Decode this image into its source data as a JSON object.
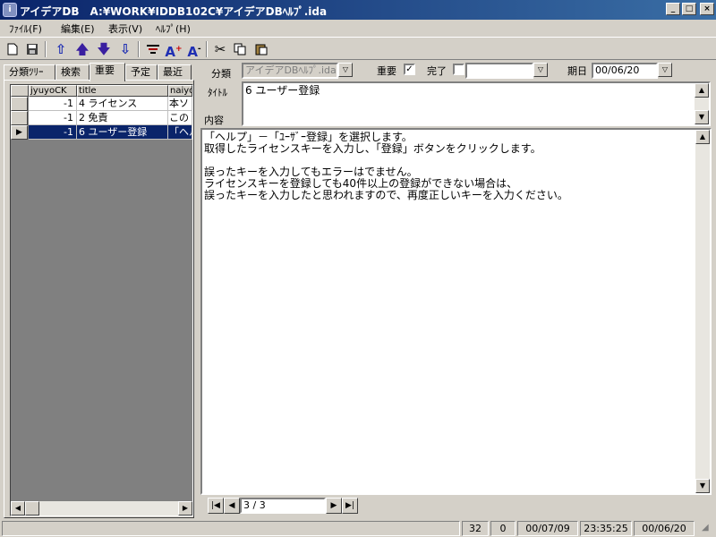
{
  "window": {
    "title": "アイデアDB　A:¥WORK¥IDDB102C¥アイデアDBﾍﾙﾌﾟ.ida",
    "icon": "app-icon",
    "controls": [
      "minimize",
      "maximize",
      "close"
    ]
  },
  "menu": [
    "ﾌｧｲﾙ(F)",
    "編集(E)",
    "表示(V)",
    "ﾍﾙﾌﾟ(H)"
  ],
  "toolbar": {
    "buttons": [
      "new",
      "save",
      "move-up",
      "up",
      "down",
      "move-down",
      "filter",
      "font-larger",
      "font-smaller",
      "cut",
      "copy",
      "paste"
    ]
  },
  "tabs": [
    "分類ﾂﾘｰ",
    "検索",
    "重要",
    "予定",
    "最近"
  ],
  "active_tab": "重要",
  "grid": {
    "columns": [
      "jyuyoCK",
      "title",
      "naiyo"
    ],
    "rows": [
      {
        "jyuyoCK": "-1",
        "title": "4 ライセンス",
        "naiyo": "本ソ",
        "selected": false
      },
      {
        "jyuyoCK": "-1",
        "title": "2 免責",
        "naiyo": "この",
        "selected": false
      },
      {
        "jyuyoCK": "-1",
        "title": "6 ユーザー登録",
        "naiyo": "「ヘル",
        "selected": true
      }
    ]
  },
  "form": {
    "bunrui_label": "分類",
    "bunrui_value": "アイデアDBﾍﾙﾌﾟ.ida",
    "juyo_label": "重要",
    "juyo_checked": true,
    "kanryo_label": "完了",
    "kanryo_checked": false,
    "kanryo_value": "",
    "kijitsu_label": "期日",
    "kijitsu_value": "00/06/20",
    "title_label": "ﾀｲﾄﾙ",
    "title_value": "6 ユーザー登録",
    "naiyo_label": "内容"
  },
  "content_lines": [
    "「ヘルプ」－「ﾕｰｻﾞｰ登録」を選択します。",
    "取得したライセンスキーを入力し、「登録」ボタンをクリックします。",
    "",
    "誤ったキーを入力してもエラーはでません。",
    "ライセンスキーを登録しても40件以上の登録ができない場合は、",
    "誤ったキーを入力したと思われますので、再度正しいキーを入力ください。"
  ],
  "navigator": {
    "position": "3 / 3"
  },
  "status": {
    "blank": "",
    "count1": "32",
    "count2": "0",
    "date": "00/07/09",
    "time": "23:35:25",
    "due": "00/06/20"
  }
}
